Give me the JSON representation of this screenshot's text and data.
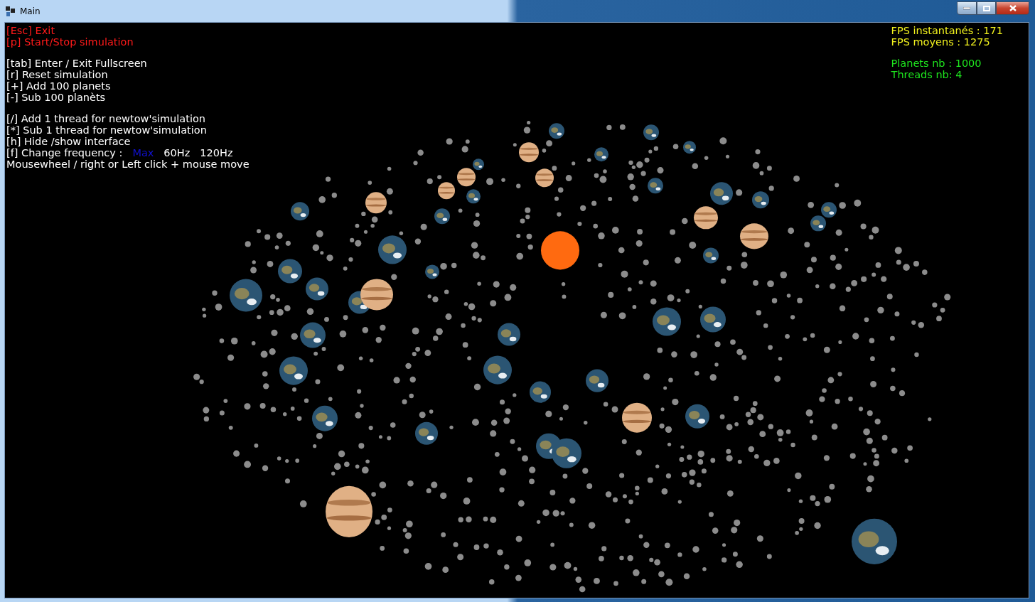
{
  "window": {
    "title": "Main"
  },
  "help": [
    [
      {
        "kind": "text",
        "text": "[Esc] Exit",
        "color": "#ff1a1a"
      },
      {
        "kind": "text",
        "text": "[p] Start/Stop simulation",
        "color": "#ff1a1a"
      }
    ],
    [
      {
        "kind": "text",
        "text": "[tab] Enter / Exit Fullscreen",
        "color": "#ffffff"
      },
      {
        "kind": "text",
        "text": "[r] Reset simulation",
        "color": "#ffffff"
      },
      {
        "kind": "text",
        "text": "[+] Add 100 planets",
        "color": "#ffffff"
      },
      {
        "kind": "text",
        "text": "[-] Sub 100 planèts",
        "color": "#ffffff"
      }
    ],
    [
      {
        "kind": "text",
        "text": "[/] Add 1 thread for newtow'simulation",
        "color": "#ffffff"
      },
      {
        "kind": "text",
        "text": "[*] Sub 1 thread for newtow'simulation",
        "color": "#ffffff"
      },
      {
        "kind": "text",
        "text": "[h] Hide /show interface",
        "color": "#ffffff"
      },
      {
        "kind": "options",
        "text": "[f] Change frequency :",
        "color": "#ffffff",
        "options": [
          {
            "label": "Max",
            "selected": true
          },
          {
            "label": "60Hz",
            "selected": false
          },
          {
            "label": "120Hz",
            "selected": false
          }
        ]
      },
      {
        "kind": "text",
        "text": "Mousewheel / right or Left click + mouse move",
        "color": "#ffffff"
      }
    ]
  ],
  "stats": [
    [
      {
        "text": "FPS instantanés : 171",
        "color": "#f2f21e"
      },
      {
        "text": "FPS moyens : 1275",
        "color": "#f2f21e"
      }
    ],
    [
      {
        "text": "Planets nb : 1000",
        "color": "#1ee61e"
      },
      {
        "text": "Threads nb: 4",
        "color": "#1ee61e"
      }
    ]
  ]
}
